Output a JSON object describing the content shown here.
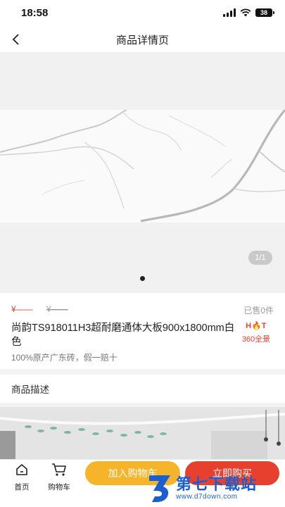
{
  "status_bar": {
    "time": "18:58",
    "battery": "38"
  },
  "nav": {
    "title": "商品详情页"
  },
  "gallery": {
    "page_indicator": "1/1"
  },
  "product": {
    "price_now": "¥——",
    "price_old": "¥——",
    "sold": "已售0件",
    "title": "尚韵TS918011H3超耐磨通体大板900x1800mm白色",
    "subtitle": "100%原产广东砖，假一赔十",
    "hot_label": "H🔥T",
    "hot_text": "360全景"
  },
  "description": {
    "title": "商品描述"
  },
  "tabbar": {
    "home_label": "首页",
    "cart_label": "购物车",
    "add_cart": "加入购物车",
    "buy_now": "立即购买"
  },
  "watermark": {
    "main": "第七下载站",
    "sub": "www.d7down.com"
  },
  "colors": {
    "accent_red": "#e8402e",
    "accent_orange": "#f5b42a",
    "watermark_blue": "#1a5fd1"
  }
}
